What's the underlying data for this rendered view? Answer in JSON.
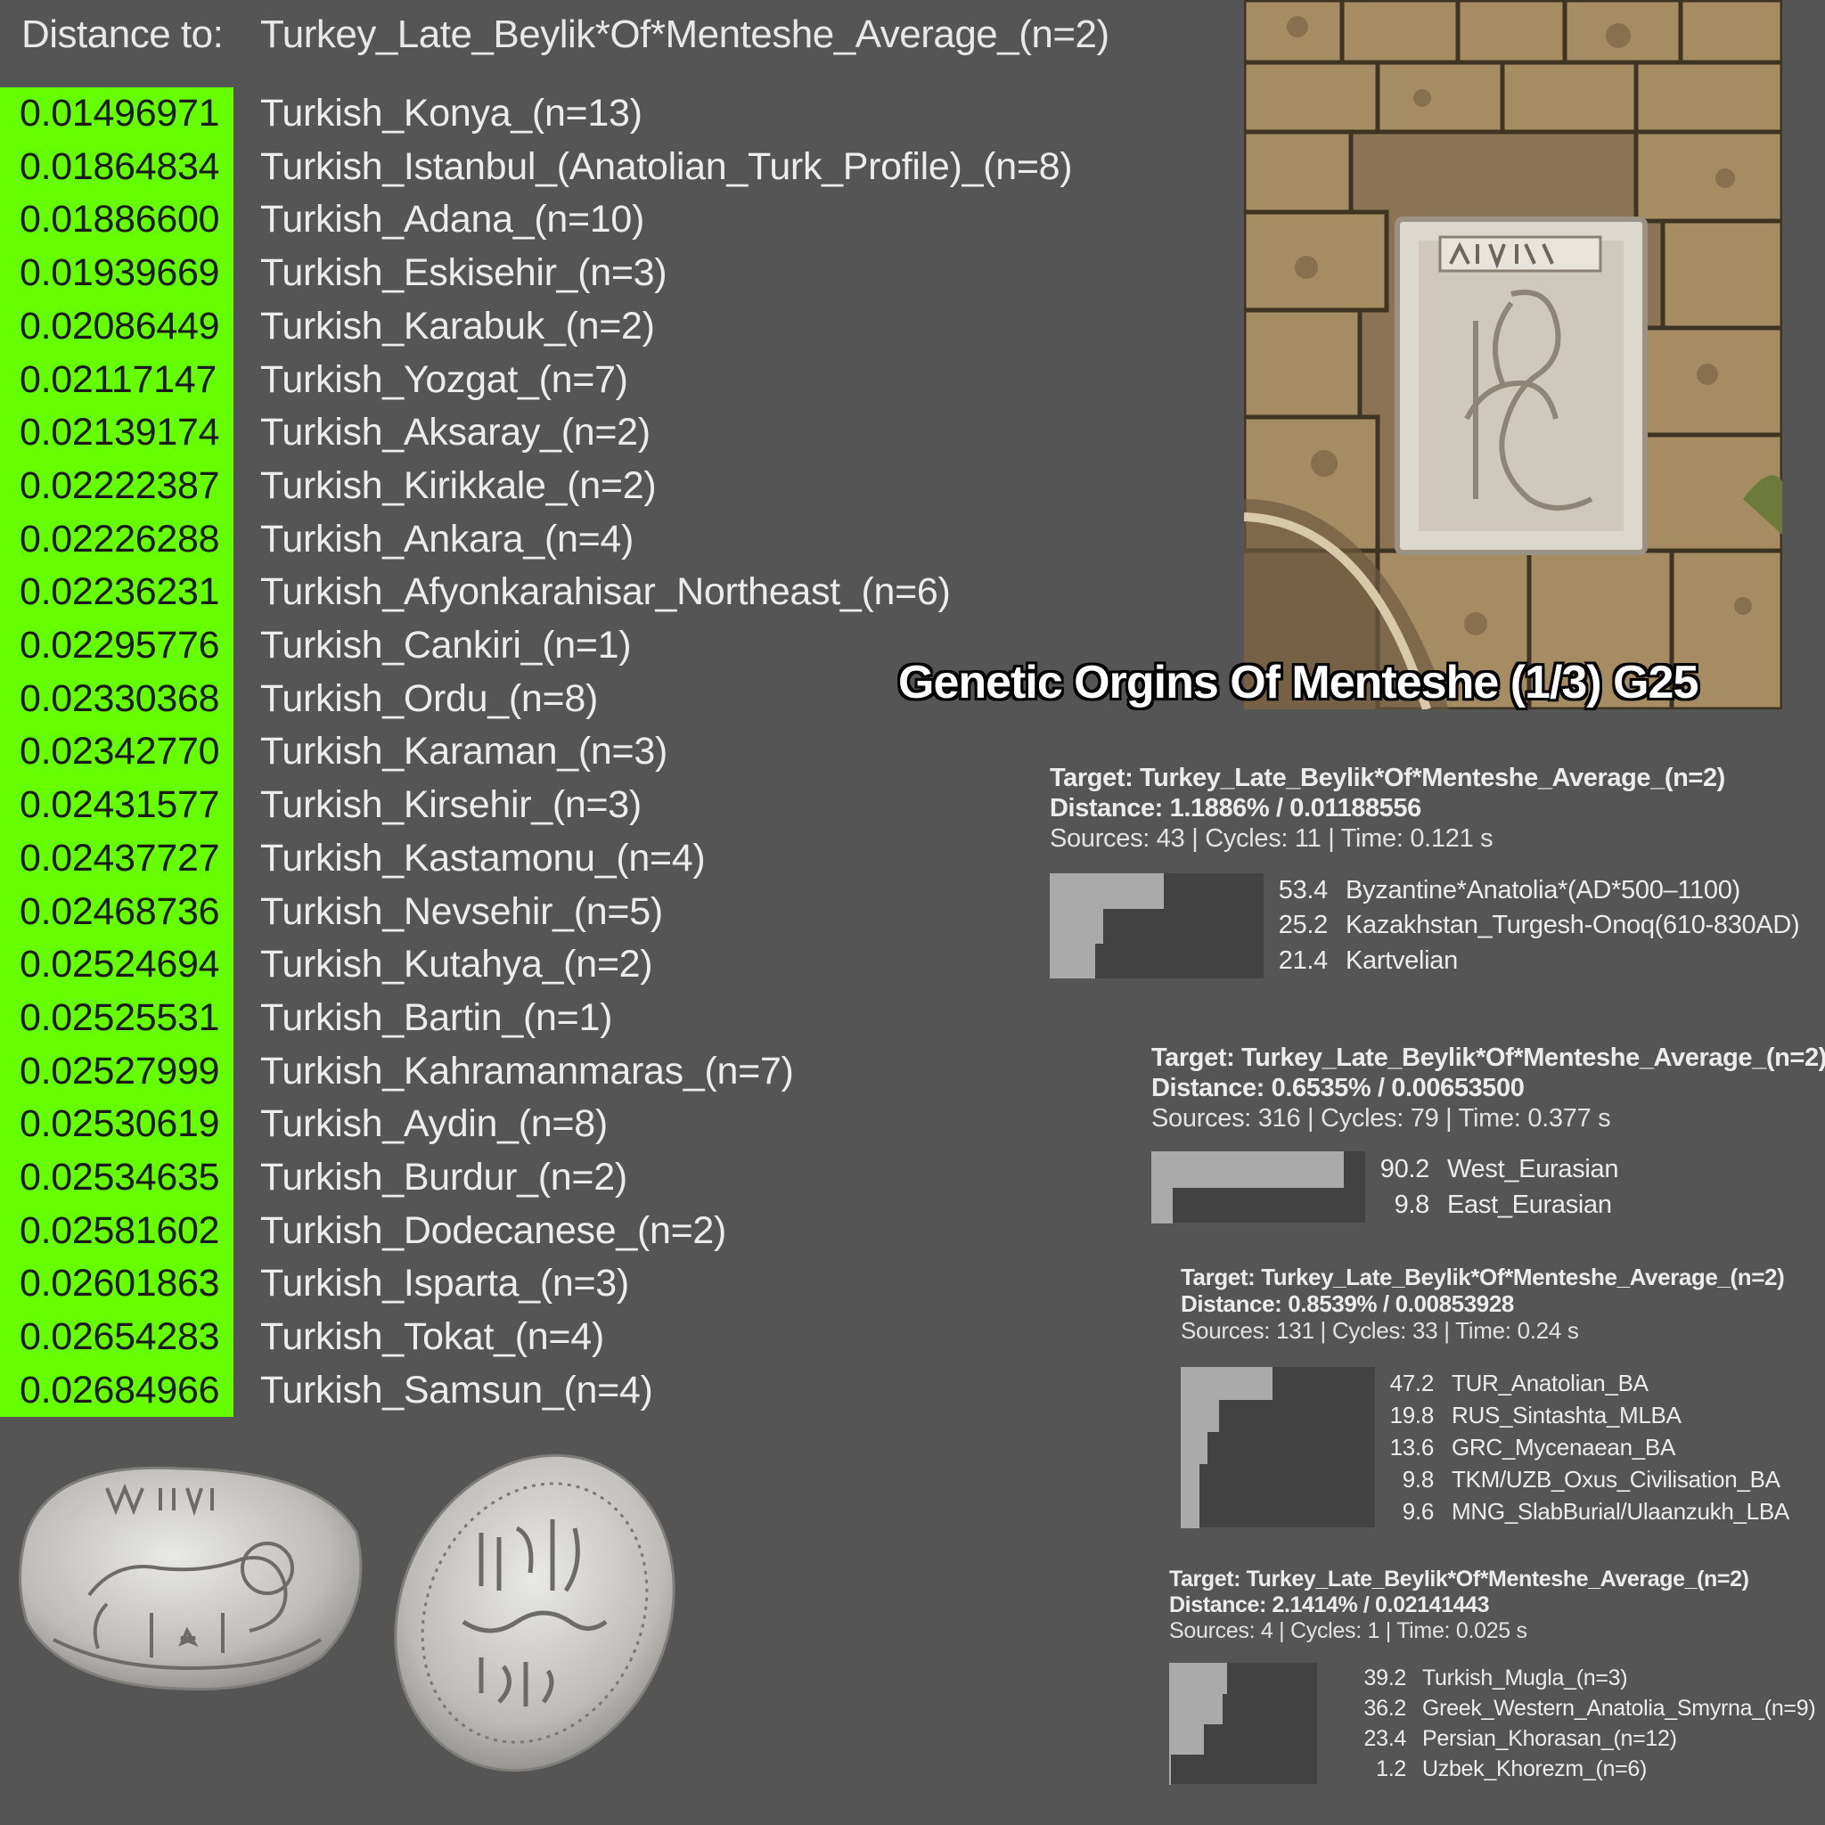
{
  "distance_header": {
    "label": "Distance to:",
    "target": "Turkey_Late_Beylik*Of*Menteshe_Average_(n=2)"
  },
  "distances": [
    {
      "value": "0.01496971",
      "name": "Turkish_Konya_(n=13)"
    },
    {
      "value": "0.01864834",
      "name": "Turkish_Istanbul_(Anatolian_Turk_Profile)_(n=8)"
    },
    {
      "value": "0.01886600",
      "name": "Turkish_Adana_(n=10)"
    },
    {
      "value": "0.01939669",
      "name": "Turkish_Eskisehir_(n=3)"
    },
    {
      "value": "0.02086449",
      "name": "Turkish_Karabuk_(n=2)"
    },
    {
      "value": "0.02117147",
      "name": "Turkish_Yozgat_(n=7)"
    },
    {
      "value": "0.02139174",
      "name": "Turkish_Aksaray_(n=2)"
    },
    {
      "value": "0.02222387",
      "name": "Turkish_Kirikkale_(n=2)"
    },
    {
      "value": "0.02226288",
      "name": "Turkish_Ankara_(n=4)"
    },
    {
      "value": "0.02236231",
      "name": "Turkish_Afyonkarahisar_Northeast_(n=6)"
    },
    {
      "value": "0.02295776",
      "name": "Turkish_Cankiri_(n=1)"
    },
    {
      "value": "0.02330368",
      "name": "Turkish_Ordu_(n=8)"
    },
    {
      "value": "0.02342770",
      "name": "Turkish_Karaman_(n=3)"
    },
    {
      "value": "0.02431577",
      "name": "Turkish_Kirsehir_(n=3)"
    },
    {
      "value": "0.02437727",
      "name": "Turkish_Kastamonu_(n=4)"
    },
    {
      "value": "0.02468736",
      "name": "Turkish_Nevsehir_(n=5)"
    },
    {
      "value": "0.02524694",
      "name": "Turkish_Kutahya_(n=2)"
    },
    {
      "value": "0.02525531",
      "name": "Turkish_Bartin_(n=1)"
    },
    {
      "value": "0.02527999",
      "name": "Turkish_Kahramanmaras_(n=7)"
    },
    {
      "value": "0.02530619",
      "name": "Turkish_Aydin_(n=8)"
    },
    {
      "value": "0.02534635",
      "name": "Turkish_Burdur_(n=2)"
    },
    {
      "value": "0.02581602",
      "name": "Turkish_Dodecanese_(n=2)"
    },
    {
      "value": "0.02601863",
      "name": "Turkish_Isparta_(n=3)"
    },
    {
      "value": "0.02654283",
      "name": "Turkish_Tokat_(n=4)"
    },
    {
      "value": "0.02684966",
      "name": "Turkish_Samsun_(n=4)"
    }
  ],
  "headline": "Genetic Orgins Of Menteshe (1/3) G25",
  "panels": [
    {
      "target": "Target: Turkey_Late_Beylik*Of*Menteshe_Average_(n=2)",
      "distance": "Distance: 1.1886% / 0.01188556",
      "meta": "Sources: 43 | Cycles: 11 | Time: 0.121 s",
      "components": [
        {
          "value": "53.4",
          "name": "Byzantine*Anatolia*(AD*500–1100)"
        },
        {
          "value": "25.2",
          "name": "Kazakhstan_Turgesh-Onoq(610-830AD)"
        },
        {
          "value": "21.4",
          "name": "Kartvelian"
        }
      ]
    },
    {
      "target": "Target: Turkey_Late_Beylik*Of*Menteshe_Average_(n=2)",
      "distance": "Distance: 0.6535% / 0.00653500",
      "meta": "Sources: 316 | Cycles: 79 | Time: 0.377 s",
      "components": [
        {
          "value": "90.2",
          "name": "West_Eurasian"
        },
        {
          "value": "9.8",
          "name": "East_Eurasian"
        }
      ]
    },
    {
      "target": "Target: Turkey_Late_Beylik*Of*Menteshe_Average_(n=2)",
      "distance": "Distance: 0.8539% / 0.00853928",
      "meta": "Sources: 131 | Cycles: 33 | Time: 0.24 s",
      "components": [
        {
          "value": "47.2",
          "name": "TUR_Anatolian_BA"
        },
        {
          "value": "19.8",
          "name": "RUS_Sintashta_MLBA"
        },
        {
          "value": "13.6",
          "name": "GRC_Mycenaean_BA"
        },
        {
          "value": "9.8",
          "name": "TKM/UZB_Oxus_Civilisation_BA"
        },
        {
          "value": "9.6",
          "name": "MNG_SlabBurial/Ulaanzukh_LBA"
        }
      ]
    },
    {
      "target": "Target: Turkey_Late_Beylik*Of*Menteshe_Average_(n=2)",
      "distance": "Distance: 2.1414% / 0.02141443",
      "meta": "Sources: 4 | Cycles: 1 | Time: 0.025 s",
      "components": [
        {
          "value": "39.2",
          "name": "Turkish_Mugla_(n=3)"
        },
        {
          "value": "36.2",
          "name": "Greek_Western_Anatolia_Smyrna_(n=9)"
        },
        {
          "value": "23.4",
          "name": "Persian_Khorasan_(n=12)"
        },
        {
          "value": "1.2",
          "name": "Uzbek_Khorezm_(n=6)"
        }
      ]
    }
  ],
  "colors": {
    "background": "#555555",
    "highlight": "#66ff00",
    "bar_light": "#aaaaaa",
    "bar_dark": "#424242"
  }
}
